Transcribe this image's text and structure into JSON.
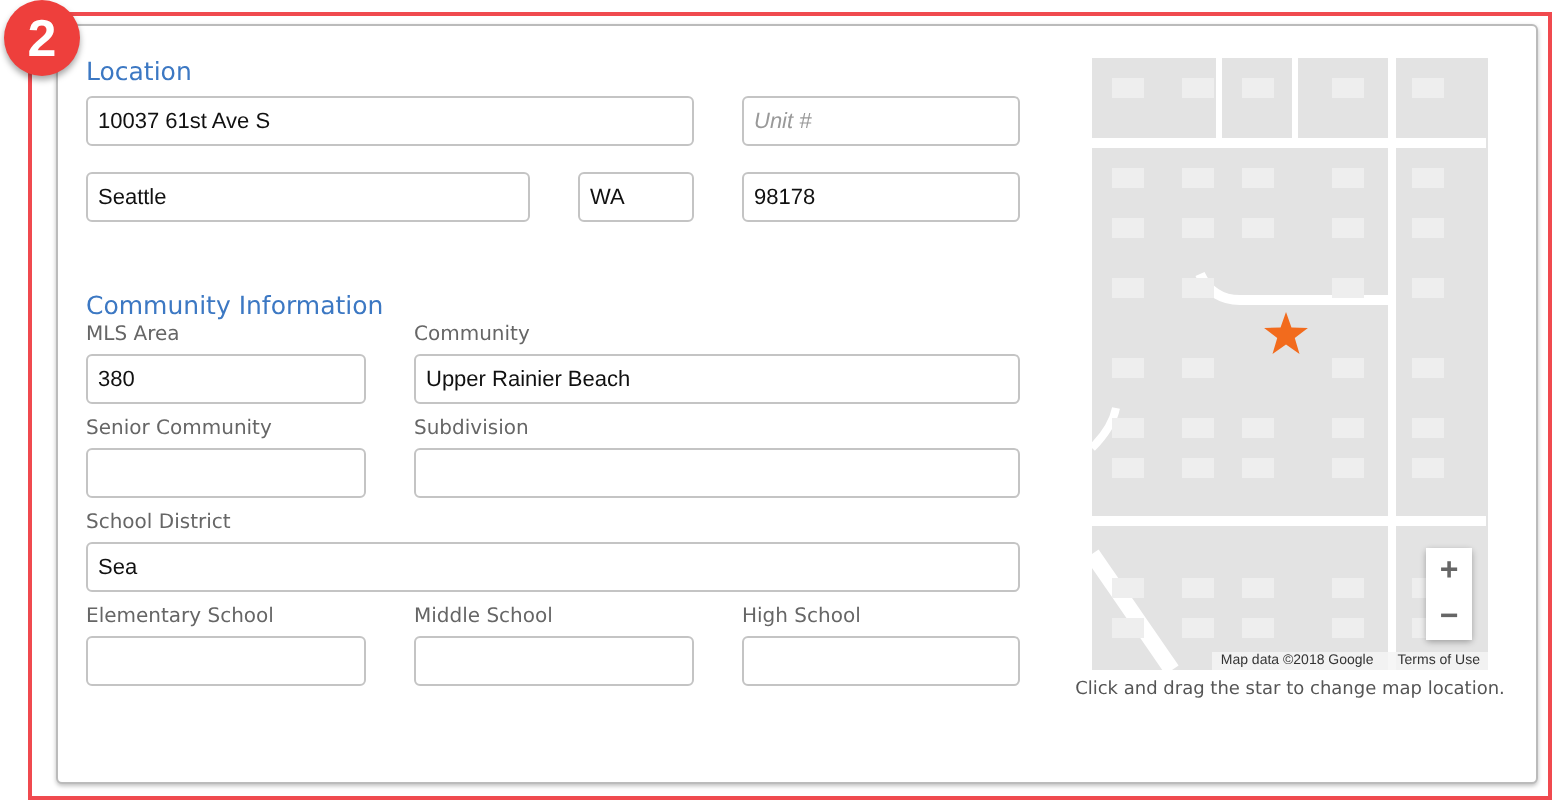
{
  "step_badge": "2",
  "location": {
    "heading": "Location",
    "fields": [
      {
        "value": "10037 61st Ave S"
      },
      {
        "placeholder": "Unit #"
      },
      {
        "value": "Seattle"
      },
      {
        "value": "WA"
      },
      {
        "value": "98178"
      }
    ]
  },
  "community": {
    "heading": "Community Information",
    "fields": [
      {
        "label": "MLS Area",
        "value": "380"
      },
      {
        "label": "Community",
        "value": "Upper Rainier Beach"
      },
      {
        "label": "Senior Community"
      },
      {
        "label": "Subdivision"
      },
      {
        "label": "School District",
        "value": "Sea"
      },
      {
        "label": "Elementary School"
      },
      {
        "label": "Middle School"
      },
      {
        "label": "High School"
      }
    ]
  },
  "map": {
    "zoom_in": "+",
    "zoom_out": "−",
    "attribution": "Map data ©2018 Google",
    "terms": "Terms of Use",
    "caption": "Click and drag the star to change map location."
  }
}
